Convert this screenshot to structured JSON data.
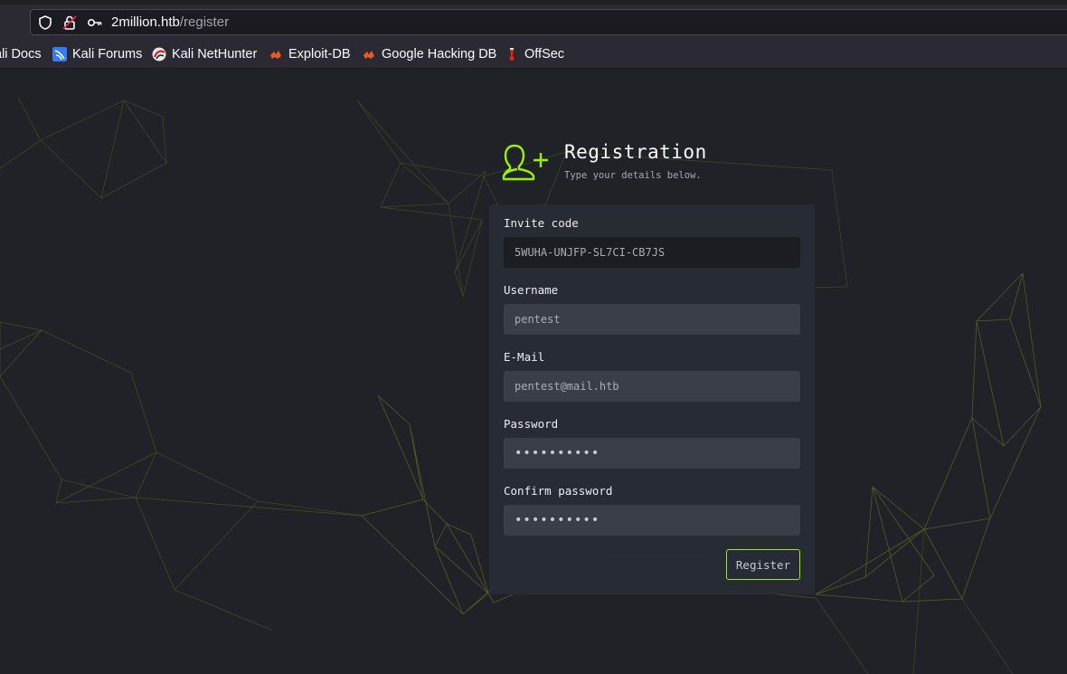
{
  "browser": {
    "url_host": "2million.htb",
    "url_path": "/register",
    "bookmarks": [
      {
        "label": "ali Docs",
        "icon": "kali-docs-icon"
      },
      {
        "label": "Kali Forums",
        "icon": "kali-forums-icon"
      },
      {
        "label": "Kali NetHunter",
        "icon": "kali-nethunter-icon"
      },
      {
        "label": "Exploit-DB",
        "icon": "exploit-db-icon"
      },
      {
        "label": "Google Hacking DB",
        "icon": "ghdb-icon"
      },
      {
        "label": "OffSec",
        "icon": "offsec-icon"
      }
    ]
  },
  "form": {
    "title": "Registration",
    "subtitle": "Type your details below.",
    "fields": {
      "invite_code": {
        "label": "Invite code",
        "value": "5WUHA-UNJFP-SL7CI-CB7JS"
      },
      "username": {
        "label": "Username",
        "value": "pentest"
      },
      "email": {
        "label": "E-Mail",
        "value": "pentest@mail.htb"
      },
      "password": {
        "label": "Password",
        "value": "••••••••••"
      },
      "confirm_password": {
        "label": "Confirm password",
        "value": "••••••••••"
      }
    },
    "submit_label": "Register"
  },
  "colors": {
    "accent": "#9fef00",
    "page_bg": "#1f2227",
    "card_bg": "#282c34",
    "input_bg": "#3a3f47"
  }
}
